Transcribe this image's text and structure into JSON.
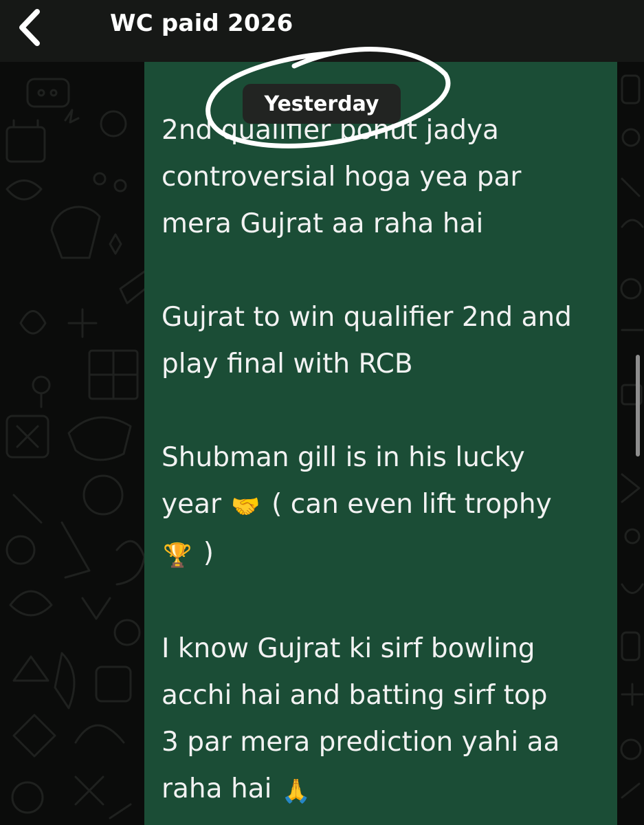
{
  "header": {
    "back_icon": "chevron-left-icon",
    "title": "WC paid 2026"
  },
  "date_divider": "Yesterday",
  "message": {
    "paragraphs": [
      {
        "lines": [
          "2nd qualifier bohut jadya",
          "controversial hoga yea par",
          "mera Gujrat aa raha hai"
        ]
      },
      {
        "lines": [
          "Gujrat to win qualifier 2nd and",
          "play final with RCB"
        ]
      },
      {
        "lines": [
          "Shubman gill is in his lucky"
        ],
        "line2_before": "year",
        "handshake_emoji": "🤝",
        "line2_after": "( can even lift trophy",
        "trophy_emoji": "🏆",
        "line3_after": ")"
      },
      {
        "lines": [
          "I know Gujrat ki sirf bowling",
          "acchi hai and batting sirf top",
          "3 par mera prediction yahi aa"
        ],
        "last_before": "raha hai",
        "pray_emoji": "🙏"
      }
    ]
  },
  "colors": {
    "header_bg": "#161816",
    "wallpaper_bg": "#0b0c0b",
    "bubble_bg": "#1b4d36",
    "text": "#f2f2f2",
    "date_pill_bg": "#222422",
    "annotation": "#ffffff"
  }
}
